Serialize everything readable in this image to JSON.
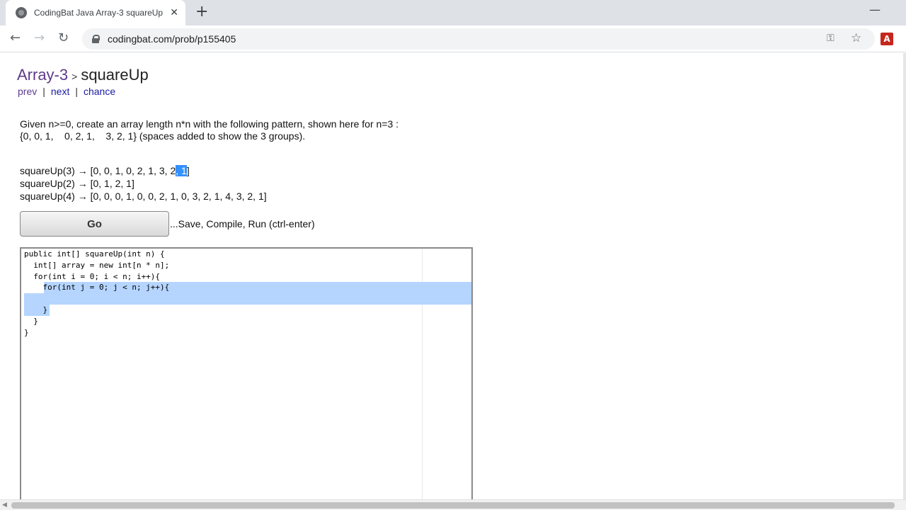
{
  "browser": {
    "tab_title": "CodingBat Java Array-3 squareUp",
    "new_tab": "+",
    "close": "✕",
    "url": "codingbat.com/prob/p155405",
    "pdf_label": "A"
  },
  "page": {
    "breadcrumb": {
      "section": "Array-3",
      "separator": ">",
      "problem": "squareUp"
    },
    "nav": {
      "prev": "prev",
      "next": "next",
      "chance": "chance",
      "bar": "|"
    },
    "description_line1": "Given n>=0, create an array length n*n with the following pattern, shown here for n=3 :",
    "description_line2": "{0, 0, 1,    0, 2, 1,    3, 2, 1} (spaces added to show the 3 groups).",
    "examples": [
      {
        "pre": "squareUp(3) → [0, 0, 1, 0, 2, 1, 3, 2",
        "selected": ", 1",
        "post": "]"
      },
      {
        "text": "squareUp(2) → [0, 1, 2, 1]"
      },
      {
        "text": "squareUp(4) → [0, 0, 0, 1, 0, 0, 2, 1, 0, 3, 2, 1, 4, 3, 2, 1]"
      }
    ],
    "go_button": "Go",
    "go_hint": "...Save, Compile, Run (ctrl-enter)"
  },
  "editor": {
    "lines": [
      "public int[] squareUp(int n) {",
      "  int[] array = new int[n * n];",
      "  for(int i = 0; i < n; i++){",
      "    for(int j = 0; j < n; j++){",
      "",
      "    }",
      "  }",
      "}"
    ]
  }
}
